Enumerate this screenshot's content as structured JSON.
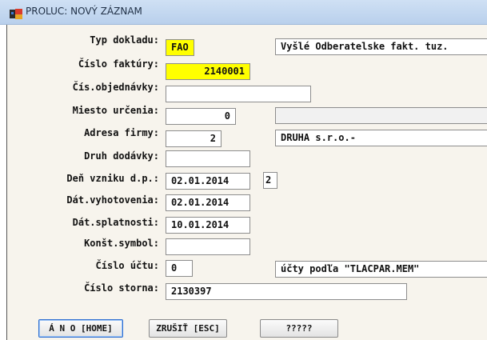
{
  "window": {
    "title": "PROLUC: NOVÝ ZÁZNAM"
  },
  "form": {
    "typ_dokladu": {
      "label": "Typ dokladu:",
      "value": "FAO",
      "description": "Vyšlé Odberatelske fakt. tuz."
    },
    "cislo_faktury": {
      "label": "Číslo faktúry:",
      "value": "2140001"
    },
    "cis_objednavky": {
      "label": "Čís.objednávky:",
      "value": ""
    },
    "miesto_urcenia": {
      "label": "Miesto určenia:",
      "value": "0",
      "description": ""
    },
    "adresa_firmy": {
      "label": "Adresa firmy:",
      "value": "2",
      "description": "DRUHA s.r.o.-"
    },
    "druh_dodavky": {
      "label": "Druh dodávky:",
      "value": ""
    },
    "den_vzniku": {
      "label": "Deň vzniku d.p.:",
      "value": "02.01.2014",
      "extra": "2"
    },
    "dat_vyhotovenia": {
      "label": "Dát.vyhotovenia:",
      "value": "02.01.2014"
    },
    "dat_splatnosti": {
      "label": "Dát.splatnosti:",
      "value": "10.01.2014"
    },
    "konst_symbol": {
      "label": "Konšt.symbol:",
      "value": ""
    },
    "cislo_uctu": {
      "label": "Číslo účtu:",
      "value": "0",
      "description": "účty podľa \"TLACPAR.MEM\""
    },
    "cislo_storna": {
      "label": "Číslo storna:",
      "value": "2130397"
    }
  },
  "buttons": {
    "yes": "Á N O [HOME]",
    "cancel": "ZRUŠIŤ [ESC]",
    "unknown": "?????"
  },
  "colors": {
    "highlight_field": "#ffff00",
    "form_background": "#f7f4ed",
    "titlebar": "#c3d7f0",
    "focus_border": "#2f6fd1"
  },
  "icons": {
    "app": "app-window-icon"
  }
}
